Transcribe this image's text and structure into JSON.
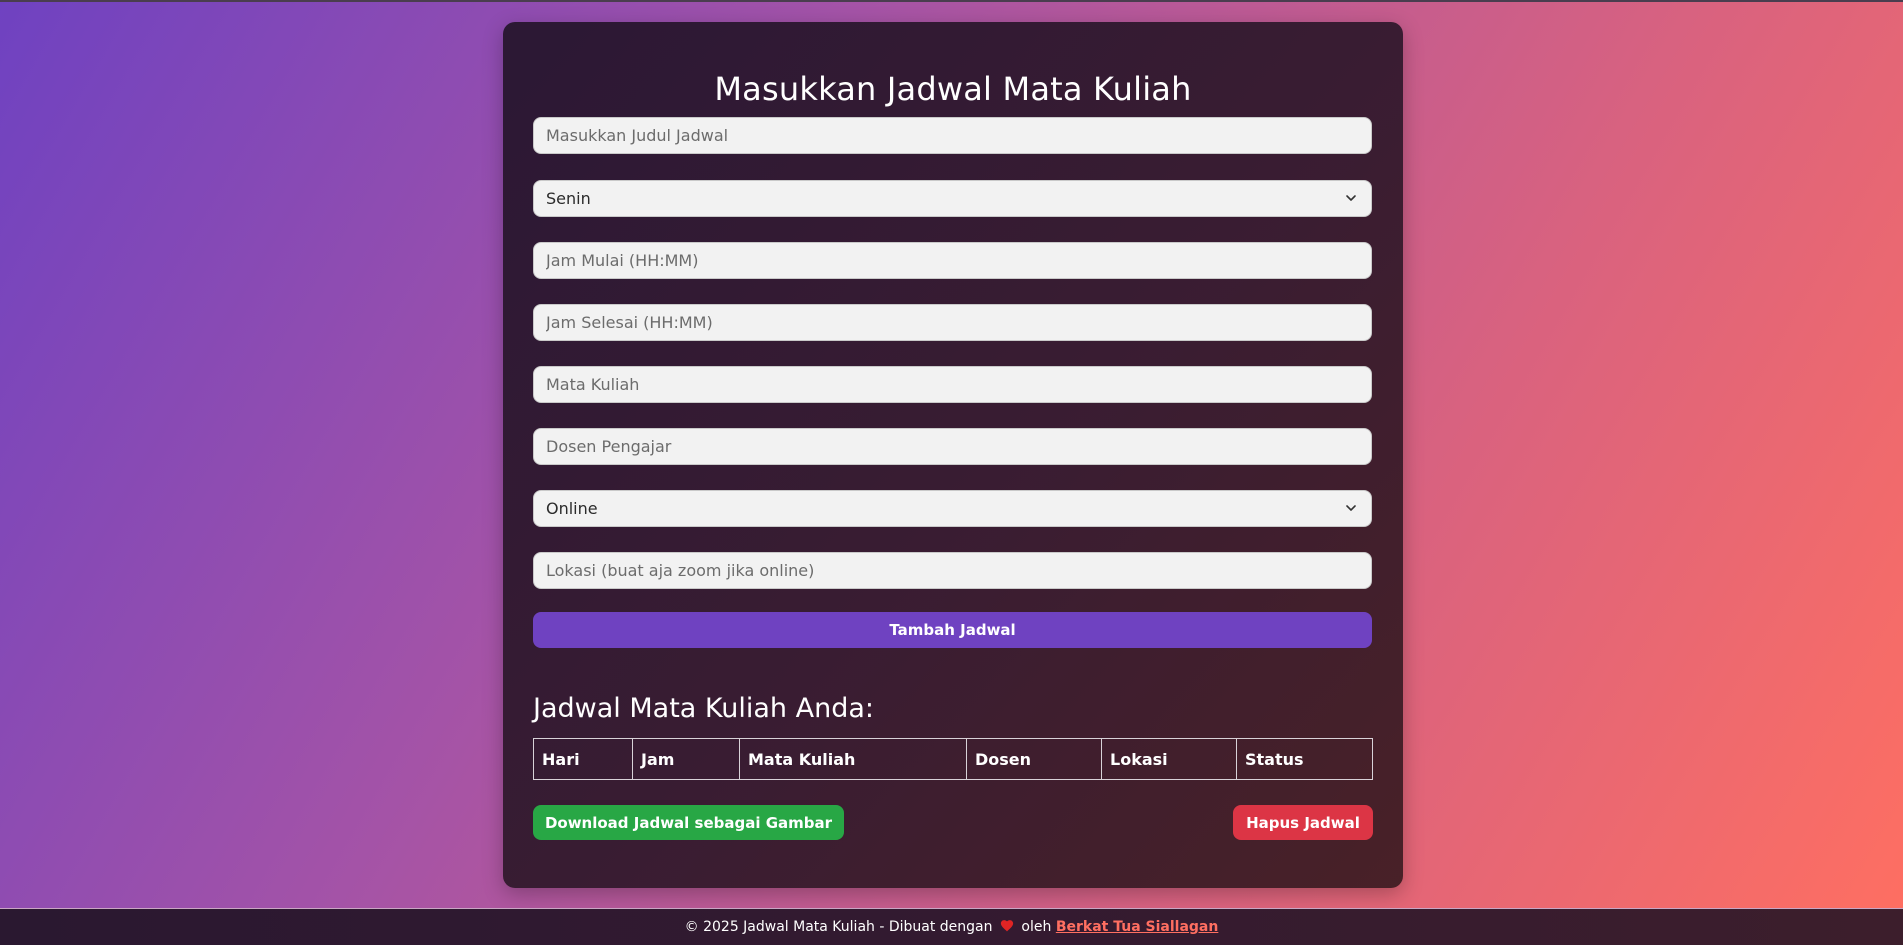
{
  "form": {
    "title": "Masukkan Jadwal Mata Kuliah",
    "judul_placeholder": "Masukkan Judul Jadwal",
    "hari_selected": "Senin",
    "jam_mulai_placeholder": "Jam Mulai (HH:MM)",
    "jam_selesai_placeholder": "Jam Selesai (HH:MM)",
    "mata_kuliah_placeholder": "Mata Kuliah",
    "dosen_placeholder": "Dosen Pengajar",
    "mode_selected": "Online",
    "lokasi_placeholder": "Lokasi (buat aja zoom jika online)",
    "add_button_label": "Tambah Jadwal"
  },
  "schedule": {
    "heading": "Jadwal Mata Kuliah Anda:",
    "columns": [
      "Hari",
      "Jam",
      "Mata Kuliah",
      "Dosen",
      "Lokasi",
      "Status"
    ],
    "rows": []
  },
  "actions": {
    "download_label": "Download Jadwal sebagai Gambar",
    "delete_label": "Hapus Jadwal"
  },
  "footer": {
    "text_before": "© 2025 Jadwal Mata Kuliah - Dibuat dengan",
    "heart_icon": "heart-icon",
    "text_after": "oleh",
    "author_link": "Berkat Tua Siallagan"
  },
  "colors": {
    "primary": "#6f42c1",
    "success": "#28a745",
    "danger": "#dc3545",
    "accent_link": "#ff6f61",
    "heart": "#e02424"
  }
}
